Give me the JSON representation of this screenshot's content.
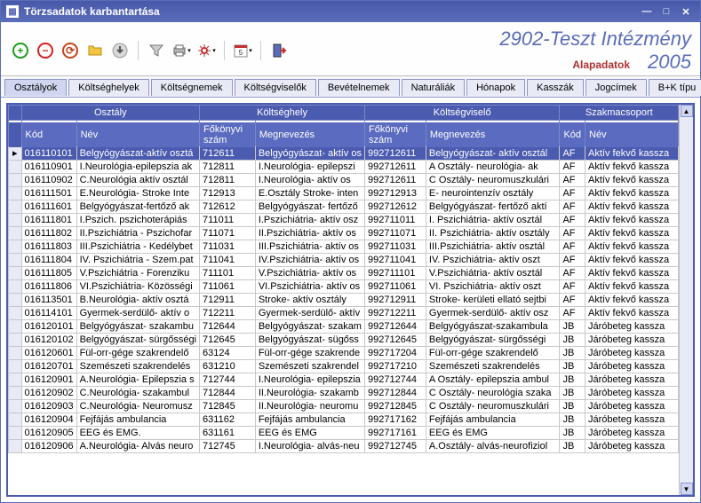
{
  "window": {
    "title": "Törzsadatok karbantartása"
  },
  "header": {
    "org": "2902-Teszt Intézmény",
    "subtitle": "Alapadatok",
    "year": "2005"
  },
  "tabs": [
    "Osztályok",
    "Költséghelyek",
    "Költségnemek",
    "Költségviselők",
    "Bevételnemek",
    "Naturáliák",
    "Hónapok",
    "Kasszák",
    "Jogcímek",
    "B+K típu"
  ],
  "activeTab": 0,
  "groupHeaders": [
    "Osztály",
    "Költséghely",
    "Költségviselő",
    "Szakmacsoport"
  ],
  "columns": [
    "Kód",
    "Név",
    "Főkönyvi szám",
    "Megnevezés",
    "Főkönyvi szám",
    "Megnevezés",
    "Kód",
    "Név"
  ],
  "rows": [
    {
      "sel": true,
      "k": "016110101",
      "n": "Belgyógyászat-aktív osztá",
      "fk": "712611",
      "m": "Belgyógyászat- aktív os",
      "fk2": "992712611",
      "m2": "Belgyógyászat- aktív osztál",
      "sk": "AF",
      "sn": "Aktív fekvő kassza"
    },
    {
      "k": "016110901",
      "n": "I.Neurológia-epilepszia ak",
      "fk": "712811",
      "m": "I.Neurológia- epilepszi",
      "fk2": "992712611",
      "m2": "A Osztály- neurológia- ak",
      "sk": "AF",
      "sn": "Aktív fekvő kassza"
    },
    {
      "k": "016110902",
      "n": "C.Neurológia aktív osztál",
      "fk": "712811",
      "m": "I.Neurológia- aktív os",
      "fk2": "992712611",
      "m2": "C Osztály- neuromuszkulári",
      "sk": "AF",
      "sn": "Aktív fekvő kassza"
    },
    {
      "k": "016111501",
      "n": "E.Neurológia- Stroke Inte",
      "fk": "712913",
      "m": "E.Osztály Stroke- inten",
      "fk2": "992712913",
      "m2": "E- neurointenzív osztály",
      "sk": "AF",
      "sn": "Aktív fekvő kassza"
    },
    {
      "k": "016111601",
      "n": "Belgyógyászat-fertőző ak",
      "fk": "712612",
      "m": "Belgyógyászat- fertőző",
      "fk2": "992712612",
      "m2": "Belgyógyászat- fertőző aktí",
      "sk": "AF",
      "sn": "Aktív fekvő kassza"
    },
    {
      "k": "016111801",
      "n": "I.Pszich. pszichoterápiás",
      "fk": "711011",
      "m": "I.Pszichiátria- aktív osz",
      "fk2": "992711011",
      "m2": "I. Pszichiátria- aktív osztál",
      "sk": "AF",
      "sn": "Aktív fekvő kassza"
    },
    {
      "k": "016111802",
      "n": "II.Pszichiátria - Pszichofar",
      "fk": "711071",
      "m": "II.Pszichiátria- aktív os",
      "fk2": "992711071",
      "m2": "II. Pszichiátria- aktív osztály",
      "sk": "AF",
      "sn": "Aktív fekvő kassza"
    },
    {
      "k": "016111803",
      "n": "III.Pszichiátria - Kedélybet",
      "fk": "711031",
      "m": "III.Pszichiátria- aktív os",
      "fk2": "992711031",
      "m2": "III.Pszichiátria- aktív osztál",
      "sk": "AF",
      "sn": "Aktív fekvő kassza"
    },
    {
      "k": "016111804",
      "n": "IV. Pszichiátria - Szem.pat",
      "fk": "711041",
      "m": "IV.Pszichiátria- aktív os",
      "fk2": "992711041",
      "m2": "IV. Pszichiátria- aktív oszt",
      "sk": "AF",
      "sn": "Aktív fekvő kassza"
    },
    {
      "k": "016111805",
      "n": "V.Pszichiátria - Forenziku",
      "fk": "711101",
      "m": "V.Pszichiátria- aktív os",
      "fk2": "992711101",
      "m2": "V.Pszichiátria- aktív osztál",
      "sk": "AF",
      "sn": "Aktív fekvő kassza"
    },
    {
      "k": "016111806",
      "n": "VI.Pszichiátria- Közösségi",
      "fk": "711061",
      "m": "VI.Pszichiátria- aktív os",
      "fk2": "992711061",
      "m2": "VI. Pszichiátria- aktív oszt",
      "sk": "AF",
      "sn": "Aktív fekvő kassza"
    },
    {
      "k": "016113501",
      "n": "B.Neurológia- aktív osztá",
      "fk": "712911",
      "m": "Stroke- aktív osztály",
      "fk2": "992712911",
      "m2": "Stroke- kerületi ellató sejtbi",
      "sk": "AF",
      "sn": "Aktív fekvő kassza"
    },
    {
      "k": "016114101",
      "n": "Gyermek-serdülő- aktív o",
      "fk": "712211",
      "m": "Gyermek-serdülő- aktív",
      "fk2": "992712211",
      "m2": "Gyermek-serdülő- aktív osz",
      "sk": "AF",
      "sn": "Aktív fekvő kassza"
    },
    {
      "k": "016120101",
      "n": "Belgyógyászat- szakambu",
      "fk": "712644",
      "m": "Belgyógyászat- szakam",
      "fk2": "992712644",
      "m2": "Belgyógyászat-szakambula",
      "sk": "JB",
      "sn": "Járóbeteg kassza"
    },
    {
      "k": "016120102",
      "n": "Belgyógyászat- sürgősségi",
      "fk": "712645",
      "m": "Belgyógyászat- sügőss",
      "fk2": "992712645",
      "m2": "Belgyógyászat- sürgősségi",
      "sk": "JB",
      "sn": "Járóbeteg kassza"
    },
    {
      "k": "016120601",
      "n": "Fül-orr-gége szakrendelő",
      "fk": "63124",
      "m": "Fül-orr-gége szakrende",
      "fk2": "992717204",
      "m2": "Fül-orr-gége szakrendelő",
      "sk": "JB",
      "sn": "Járóbeteg kassza"
    },
    {
      "k": "016120701",
      "n": "Szemészeti szakrendelés",
      "fk": "631210",
      "m": "Szemészeti szakrendel",
      "fk2": "992717210",
      "m2": "Szemészeti szakrendelés",
      "sk": "JB",
      "sn": "Járóbeteg kassza"
    },
    {
      "k": "016120901",
      "n": "A.Neurológia- Epilepszia s",
      "fk": "712744",
      "m": "I.Neurológia- epilepszia",
      "fk2": "992712744",
      "m2": "A Osztály- epilepszia ambul",
      "sk": "JB",
      "sn": "Járóbeteg kassza"
    },
    {
      "k": "016120902",
      "n": "C.Neurológia- szakambul",
      "fk": "712844",
      "m": "II.Neurológia- szakamb",
      "fk2": "992712844",
      "m2": "C Osztály- neurológia szaka",
      "sk": "JB",
      "sn": "Járóbeteg kassza"
    },
    {
      "k": "016120903",
      "n": "C.Neurológia- Neuromusz",
      "fk": "712845",
      "m": "II.Neurológia- neuromu",
      "fk2": "992712845",
      "m2": "C Osztály- neuromuszkulári",
      "sk": "JB",
      "sn": "Járóbeteg kassza"
    },
    {
      "k": "016120904",
      "n": "Fejfájás ambulancia",
      "fk": "631162",
      "m": "Fejfájás ambulancia",
      "fk2": "992717162",
      "m2": "Fejfájás ambulancia",
      "sk": "JB",
      "sn": "Járóbeteg kassza"
    },
    {
      "k": "016120905",
      "n": "EEG és EMG.",
      "fk": "631161",
      "m": "EEG és EMG",
      "fk2": "992717161",
      "m2": "EEG és EMG",
      "sk": "JB",
      "sn": "Járóbeteg kassza"
    },
    {
      "k": "016120906",
      "n": "A.Neurológia- Alvás neuro",
      "fk": "712745",
      "m": "I.Neurológia- alvás-neu",
      "fk2": "992712745",
      "m2": "A.Osztály- alvás-neurofiziol",
      "sk": "JB",
      "sn": "Járóbeteg kassza"
    }
  ]
}
